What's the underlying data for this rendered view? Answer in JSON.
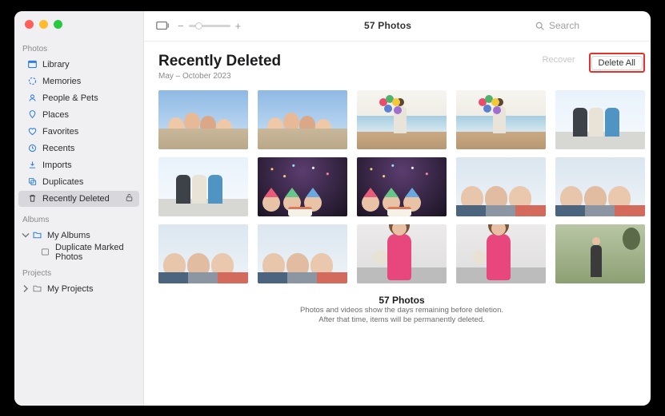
{
  "toolbar": {
    "title": "57 Photos",
    "search_placeholder": "Search"
  },
  "sidebar": {
    "sections": {
      "photos": {
        "label": "Photos"
      },
      "albums": {
        "label": "Albums"
      },
      "projects": {
        "label": "Projects"
      }
    },
    "items": {
      "library": "Library",
      "memories": "Memories",
      "people": "People & Pets",
      "places": "Places",
      "favorites": "Favorites",
      "recents": "Recents",
      "imports": "Imports",
      "duplicates": "Duplicates",
      "recently_deleted": "Recently Deleted",
      "my_albums": "My Albums",
      "dup_marked": "Duplicate Marked Photos",
      "my_projects": "My Projects"
    }
  },
  "header": {
    "title": "Recently Deleted",
    "date_range": "May – October 2023",
    "recover": "Recover",
    "delete_all": "Delete All"
  },
  "footer": {
    "count": "57 Photos",
    "line1": "Photos and videos show the days remaining before deletion.",
    "line2": "After that time, items will be permanently deleted."
  }
}
